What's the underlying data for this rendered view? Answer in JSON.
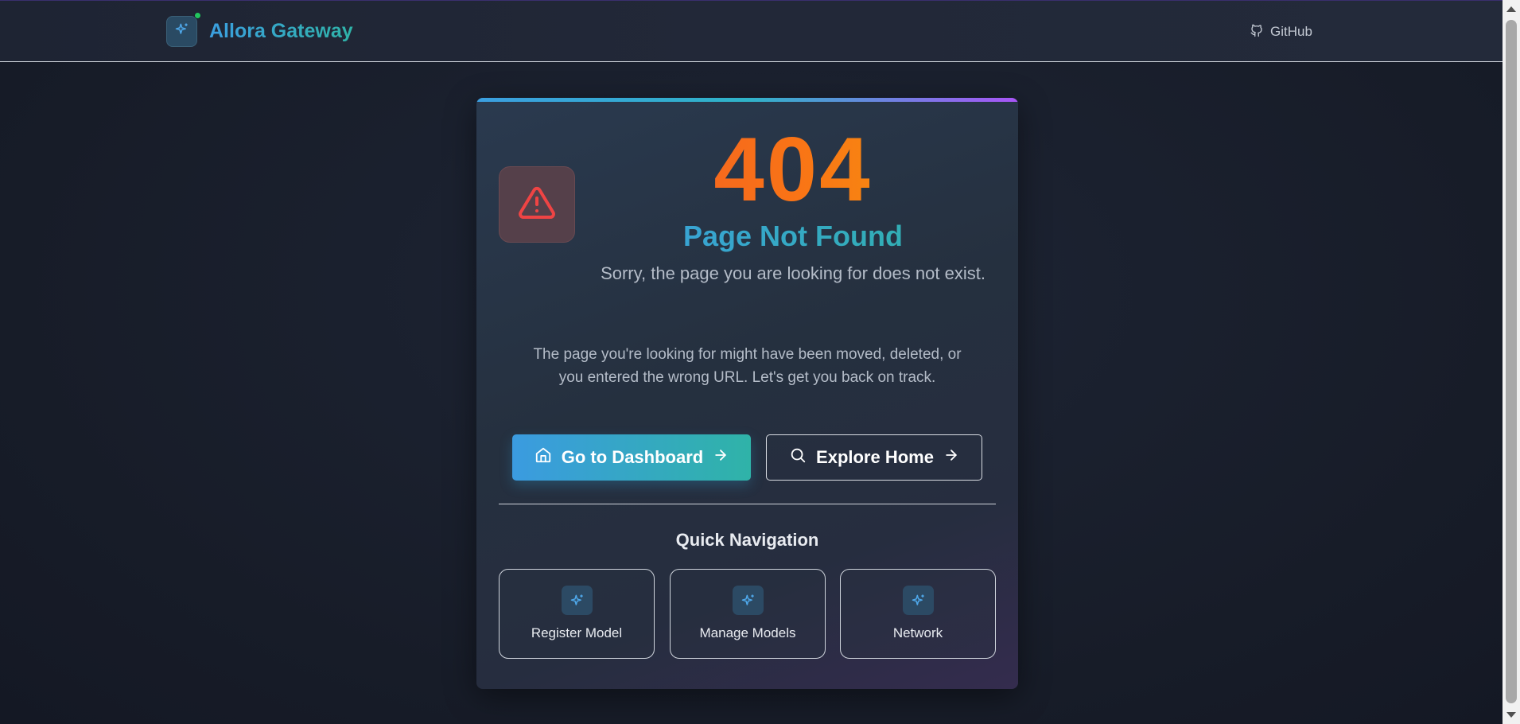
{
  "header": {
    "brand": "Allora Gateway",
    "github_label": "GitHub"
  },
  "error": {
    "code": "404",
    "title": "Page Not Found",
    "subtitle": "Sorry, the page you are looking for does not exist.",
    "description": "The page you're looking for might have been moved, deleted, or you entered the wrong URL. Let's get you back on track."
  },
  "actions": {
    "dashboard_label": "Go to Dashboard",
    "explore_label": "Explore Home"
  },
  "quick_nav": {
    "title": "Quick Navigation",
    "items": [
      {
        "label": "Register Model",
        "icon": "sparkles-icon"
      },
      {
        "label": "Manage Models",
        "icon": "sparkles-icon"
      },
      {
        "label": "Network",
        "icon": "sparkles-icon"
      }
    ]
  },
  "colors": {
    "accent_blue": "#3b9fe0",
    "accent_teal": "#2fb3a8",
    "error_orange": "#f97316",
    "warning_red": "#ef4444",
    "status_dot": "#22c55e"
  }
}
